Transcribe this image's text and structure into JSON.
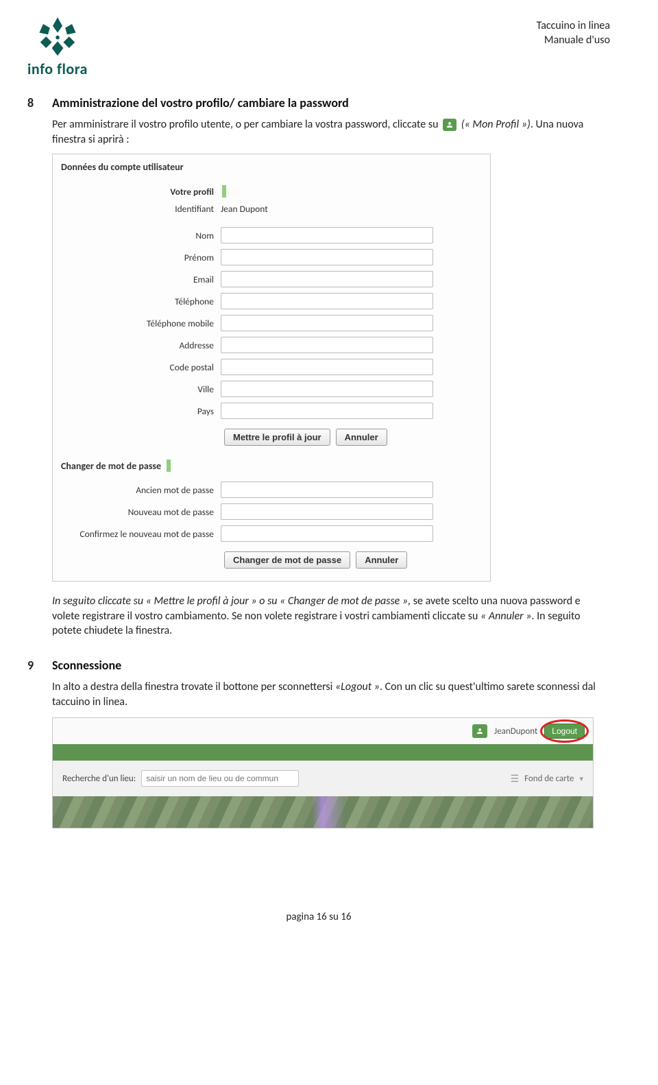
{
  "header": {
    "logo_name": "info flora",
    "meta_line1": "Taccuino in linea",
    "meta_line2": "Manuale d'uso"
  },
  "section8": {
    "num": "8",
    "title": "Amministrazione del vostro profilo/ cambiare la password",
    "p1a": "Per amministrare il vostro profilo utente, o per cambiare la vostra password, cliccate su ",
    "p1b": "(« Mon Profil »)",
    "p1c": ". Una nuova finestra si aprirà :",
    "panel": {
      "title": "Données du compte utilisateur",
      "profile_header": "Votre profil",
      "id_label": "Identifiant",
      "id_value": "Jean Dupont",
      "fields": [
        {
          "label": "Nom"
        },
        {
          "label": "Prénom"
        },
        {
          "label": "Email"
        },
        {
          "label": "Téléphone"
        },
        {
          "label": "Téléphone mobile"
        },
        {
          "label": "Addresse"
        },
        {
          "label": "Code postal"
        },
        {
          "label": "Ville"
        },
        {
          "label": "Pays"
        }
      ],
      "btn_update": "Mettre le profil à jour",
      "btn_cancel": "Annuler",
      "pwd_header": "Changer de mot de passe",
      "pwd_fields": [
        {
          "label": "Ancien mot de passe"
        },
        {
          "label": "Nouveau mot de passe"
        },
        {
          "label": "Confirmez le nouveau mot de passe"
        }
      ],
      "btn_pwd": "Changer de mot de passe",
      "btn_cancel2": "Annuler"
    },
    "p2": "In seguito cliccate su « Mettre le profil à jour » o su « Changer de mot de passe », se avete scelto una nuova password e volete registrare il vostro cambiamento. Se non volete registrare i vostri cambiamenti cliccate su « Annuler ». In seguito potete chiudete la finestra."
  },
  "section9": {
    "num": "9",
    "title": "Sconnessione",
    "p1": "In alto a destra della finestra trovate il bottone per sconnettersi «Logout ». Con un clic su quest'ultimo sarete sconnessi dal taccuino in linea.",
    "topbar": {
      "username": "JeanDupont",
      "logout": "Logout",
      "search_label": "Recherche d'un lieu:",
      "search_placeholder": "saisir un nom de lieu ou de commun",
      "fond_label": "Fond de carte"
    }
  },
  "footer": "pagina 16 su 16"
}
